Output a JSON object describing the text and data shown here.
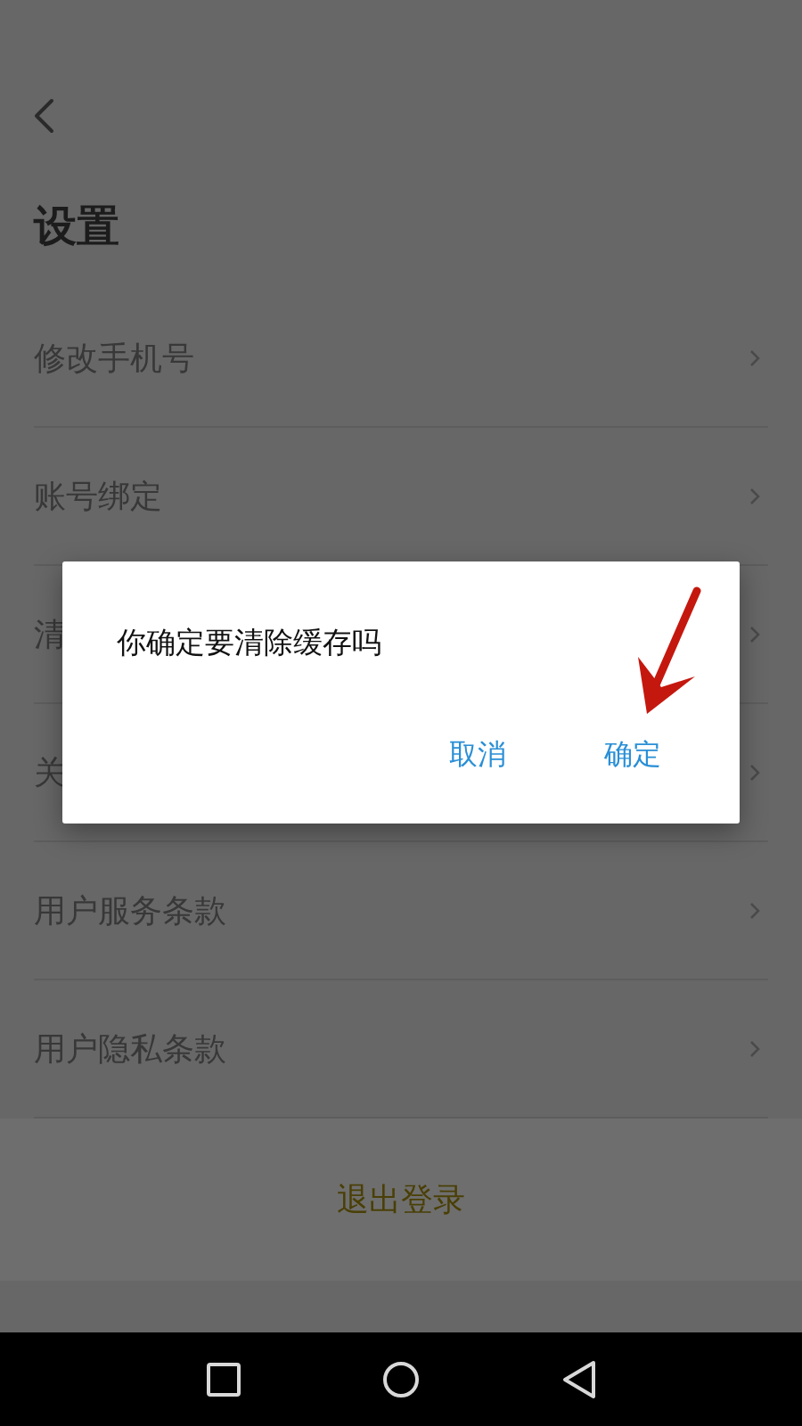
{
  "page_title": "设置",
  "rows": [
    {
      "label": "修改手机号"
    },
    {
      "label": "账号绑定"
    },
    {
      "label": "清"
    },
    {
      "label": "关"
    },
    {
      "label": "用户服务条款"
    },
    {
      "label": "用户隐私条款"
    }
  ],
  "logout": "退出登录",
  "dialog": {
    "message": "你确定要清除缓存吗",
    "buttons": [
      {
        "label": "取消"
      },
      {
        "label": "确定"
      }
    ]
  }
}
